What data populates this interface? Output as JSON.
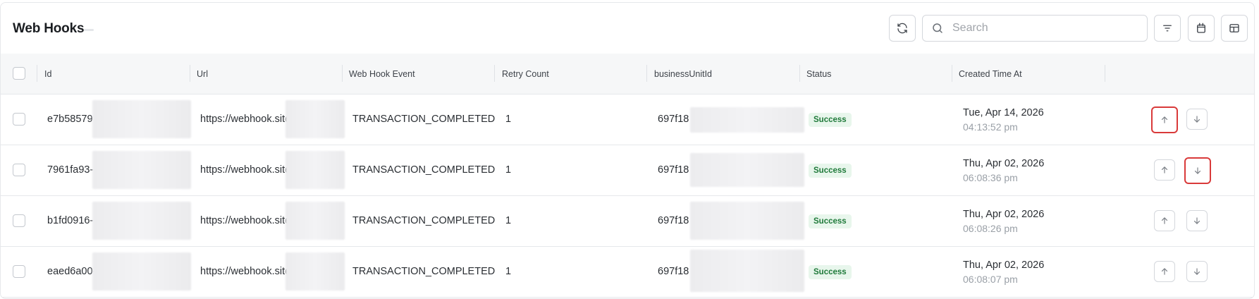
{
  "header": {
    "title": "Web Hooks"
  },
  "search": {
    "placeholder": "Search"
  },
  "table": {
    "columns": [
      "Id",
      "Url",
      "Web Hook Event",
      "Retry Count",
      "businessUnitId",
      "Status",
      "Created Time At"
    ],
    "rows": [
      {
        "id": "e7b58579",
        "url": "https://webhook.site/",
        "event": "TRANSACTION_COMPLETED",
        "retry": "1",
        "bu": "697f18",
        "status": "Success",
        "date": "Tue, Apr 14, 2026",
        "time": "04:13:52 pm"
      },
      {
        "id": "7961fa93-",
        "url": "https://webhook.site/",
        "event": "TRANSACTION_COMPLETED",
        "retry": "1",
        "bu": "697f18",
        "status": "Success",
        "date": "Thu, Apr 02, 2026",
        "time": "06:08:36 pm"
      },
      {
        "id": "b1fd0916-",
        "url": "https://webhook.site/",
        "event": "TRANSACTION_COMPLETED",
        "retry": "1",
        "bu": "697f18",
        "status": "Success",
        "date": "Thu, Apr 02, 2026",
        "time": "06:08:26 pm"
      },
      {
        "id": "eaed6a00-",
        "url": "https://webhook.site/",
        "event": "TRANSACTION_COMPLETED",
        "retry": "1",
        "bu": "697f18",
        "status": "Success",
        "date": "Thu, Apr 02, 2026",
        "time": "06:08:07 pm"
      }
    ]
  },
  "icons": {
    "refresh": "refresh-icon",
    "search": "search-icon",
    "filter": "filter-icon",
    "calendar": "calendar-icon",
    "columns": "columns-icon",
    "up": "arrow-up-icon",
    "down": "arrow-down-icon"
  },
  "colors": {
    "success_bg": "#e8f6ec",
    "success_text": "#1f7a3a",
    "highlight": "#d93a3a"
  }
}
